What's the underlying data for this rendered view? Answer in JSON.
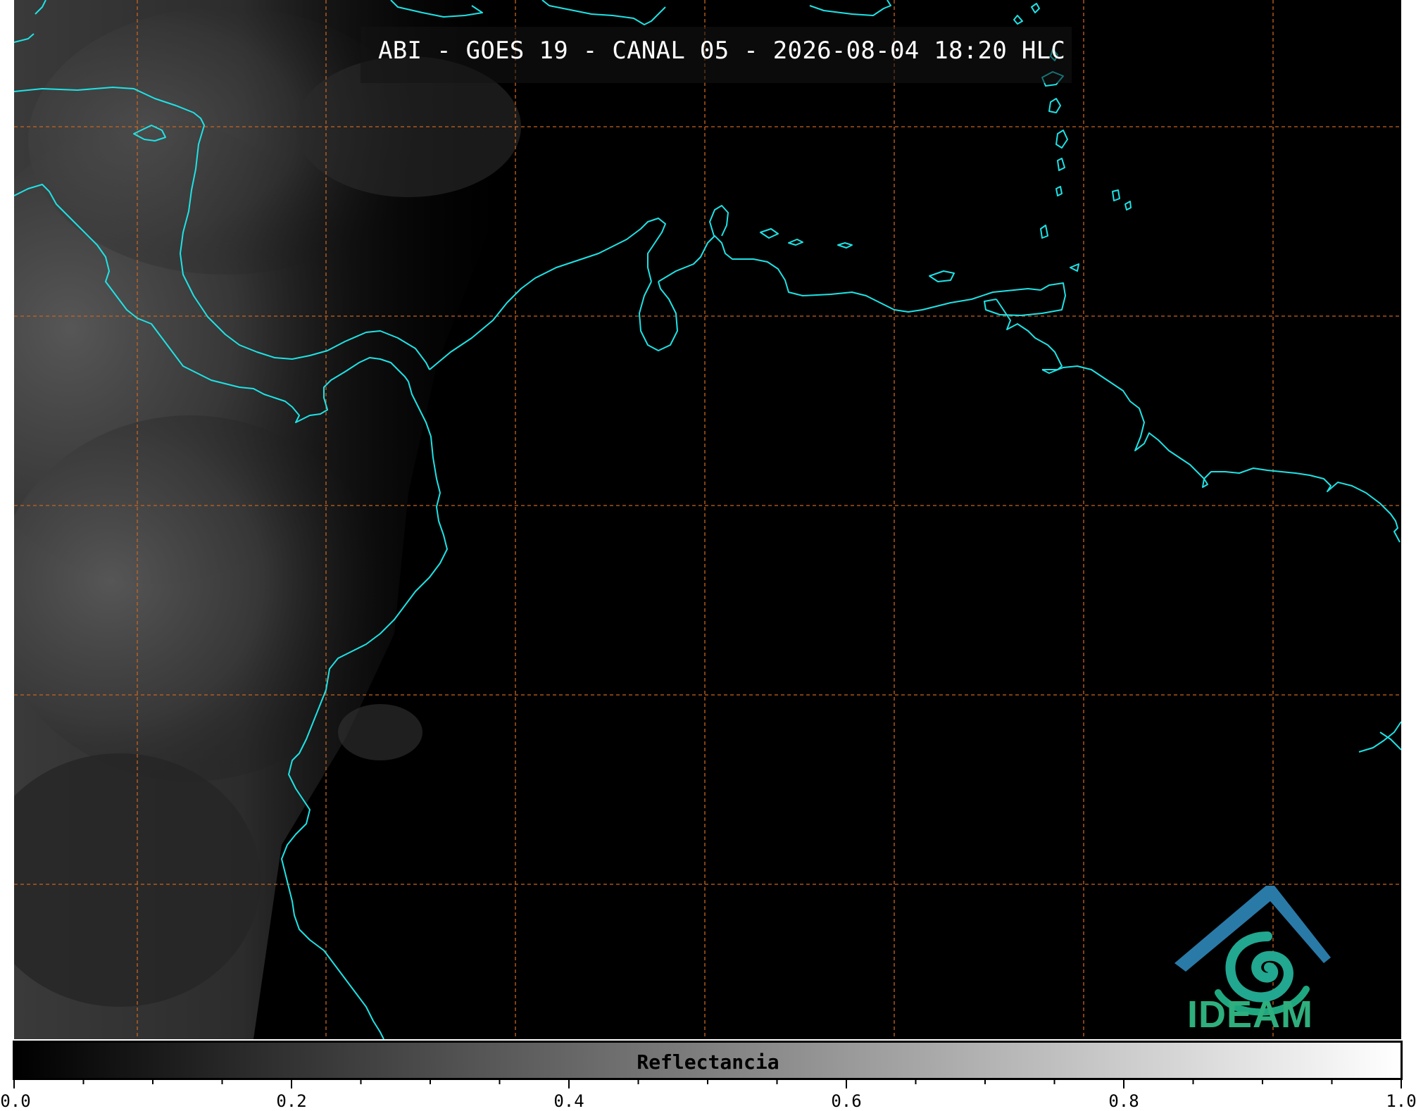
{
  "title": "ABI - GOES 19 - CANAL 05 - 2026-08-04 18:20 HLC",
  "colorbar": {
    "label": "Reflectancia",
    "ticks": [
      "0.0",
      "0.2",
      "0.4",
      "0.6",
      "0.8",
      "1.0"
    ],
    "range": [
      0.0,
      1.0
    ],
    "colormap": [
      "#000000",
      "#ffffff"
    ]
  },
  "logo": {
    "text": "IDEAM"
  },
  "colors": {
    "coastline": "#1ee3e6",
    "graticule": "#c8641e",
    "background": "#000000",
    "logo_teal": "#22a790",
    "logo_blue": "#2a7aa8"
  },
  "icons": {
    "logo": "ideam-logo-icon"
  }
}
